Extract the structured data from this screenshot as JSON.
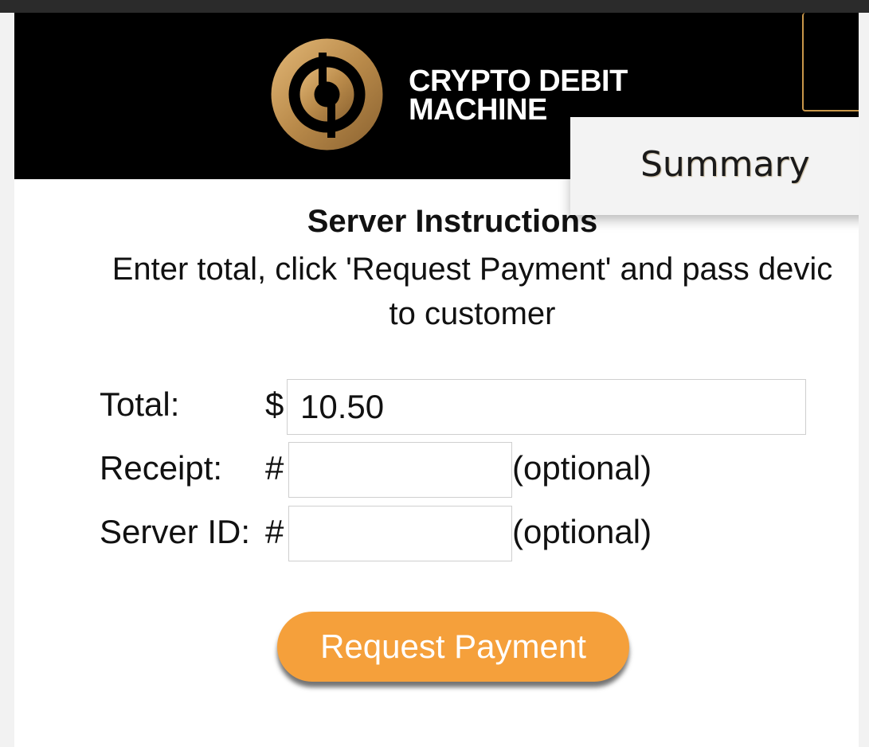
{
  "header": {
    "logo_line1": "CRYPTO DEBIT",
    "logo_line2": "MACHINE",
    "logo_icon": "crypto-debit-coin-logo"
  },
  "menu": {
    "items": [
      {
        "label": "Summary"
      }
    ]
  },
  "instructions": {
    "title": "Server Instructions",
    "line1": "Enter total, click 'Request Payment' and pass devic",
    "line2": "to customer"
  },
  "form": {
    "total": {
      "label": "Total:",
      "prefix": "$",
      "value": "10.50"
    },
    "receipt": {
      "label": "Receipt:",
      "prefix": "#",
      "value": "",
      "note": "(optional)"
    },
    "server_id": {
      "label": "Server ID:",
      "prefix": "#",
      "value": "",
      "note": "(optional)"
    }
  },
  "actions": {
    "request_payment": "Request Payment"
  },
  "colors": {
    "header_bg": "#000000",
    "accent_orange": "#f5a03b",
    "logo_gold": "#c9974a"
  }
}
